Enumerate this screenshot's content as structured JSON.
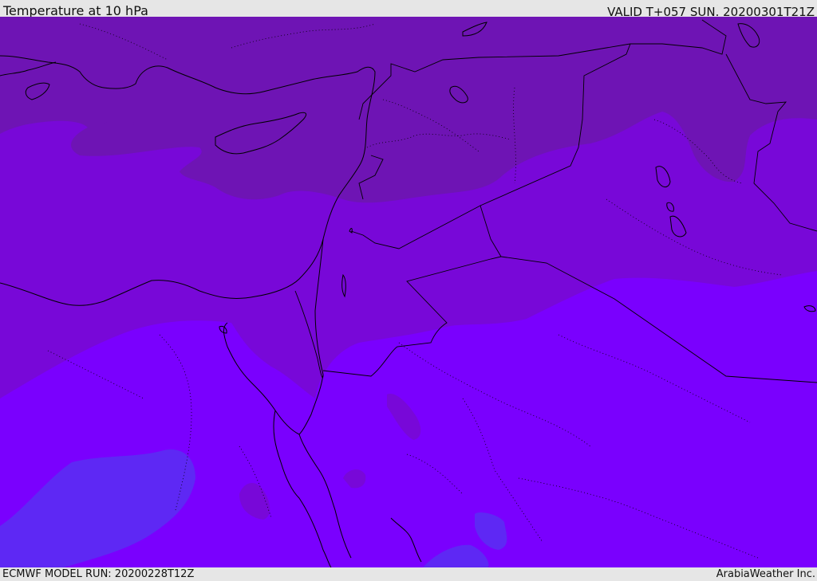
{
  "header": {
    "title": "Temperature at 10 hPa",
    "valid": "VALID T+057 SUN. 20200301T21Z"
  },
  "footer": {
    "model_run": "ECMWF MODEL RUN: 20200228T12Z",
    "brand": "ArabiaWeather Inc."
  },
  "colors": {
    "band_cold": "#6e14b4",
    "band_mid": "#7808d8",
    "band_warm": "#7a00fe",
    "band_warmest": "#5e28f4",
    "coastline": "#000000"
  }
}
